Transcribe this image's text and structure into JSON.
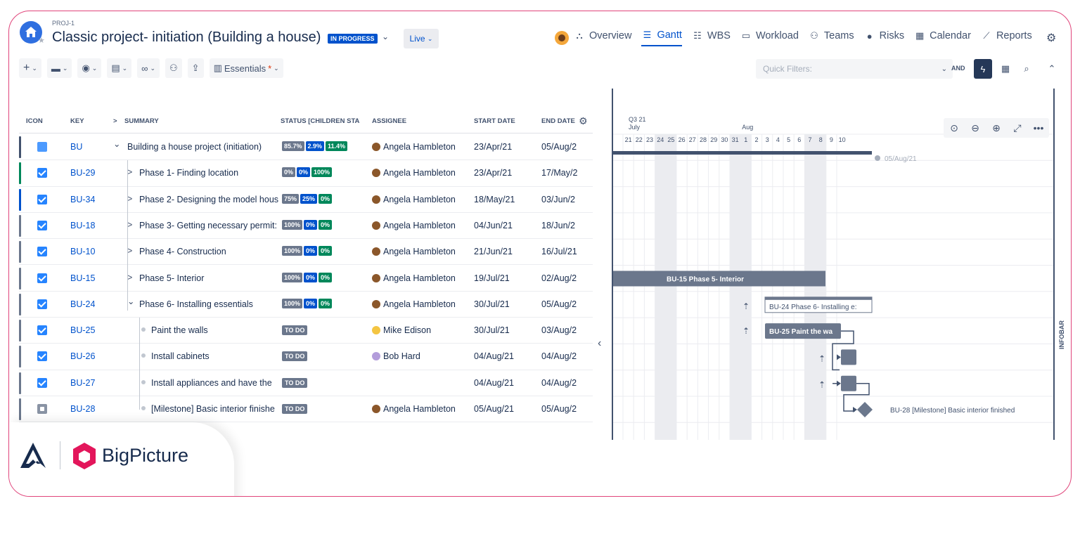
{
  "project": {
    "key": "PROJ-1",
    "title": "Classic project- initiation (Building a house)",
    "status": "IN PROGRESS",
    "mode": "Live"
  },
  "nav": [
    {
      "label": "Overview",
      "icon": "hierarchy-icon"
    },
    {
      "label": "Gantt",
      "icon": "gantt-icon",
      "active": true
    },
    {
      "label": "WBS",
      "icon": "list-icon"
    },
    {
      "label": "Workload",
      "icon": "workload-icon"
    },
    {
      "label": "Teams",
      "icon": "teams-icon"
    },
    {
      "label": "Risks",
      "icon": "risk-icon"
    },
    {
      "label": "Calendar",
      "icon": "calendar-icon"
    },
    {
      "label": "Reports",
      "icon": "chart-icon"
    }
  ],
  "toolbar": {
    "view_name": "Essentials",
    "view_required_mark": "*",
    "quick_filter_placeholder": "Quick Filters:",
    "and_label": "AND"
  },
  "columns": {
    "icon": "ICON",
    "key": "KEY",
    "summary": "SUMMARY",
    "status": "STATUS [CHILDREN STATUS]",
    "assignee": "ASSIGNEE",
    "start": "START DATE",
    "end": "END DATE"
  },
  "rows": [
    {
      "type": "story",
      "key": "BU",
      "caret": "⌄",
      "summary": "Building a house project (initiation)",
      "progress": [
        "85.7%",
        "2.9%",
        "11.4%"
      ],
      "assignee": "Angela Hambleton",
      "start": "23/Apr/21",
      "end": "05/Aug/2",
      "color": "#42526e"
    },
    {
      "type": "task",
      "key": "BU-29",
      "caret": ">",
      "summary": "Phase 1- Finding location",
      "progress": [
        "0%",
        "0%",
        "100%"
      ],
      "assignee": "Angela Hambleton",
      "start": "23/Apr/21",
      "end": "17/May/2",
      "color": "#00875a"
    },
    {
      "type": "task",
      "key": "BU-34",
      "caret": ">",
      "summary": "Phase 2- Designing the model hous",
      "progress": [
        "75%",
        "25%",
        "0%"
      ],
      "assignee": "Angela Hambleton",
      "start": "18/May/21",
      "end": "03/Jun/2",
      "color": "#0052cc"
    },
    {
      "type": "task",
      "key": "BU-18",
      "caret": ">",
      "summary": "Phase 3- Getting necessary permit:",
      "progress": [
        "100%",
        "0%",
        "0%"
      ],
      "assignee": "Angela Hambleton",
      "start": "04/Jun/21",
      "end": "18/Jun/2",
      "color": "#6b778c"
    },
    {
      "type": "task",
      "key": "BU-10",
      "caret": ">",
      "summary": "Phase 4- Construction",
      "progress": [
        "100%",
        "0%",
        "0%"
      ],
      "assignee": "Angela Hambleton",
      "start": "21/Jun/21",
      "end": "16/Jul/21",
      "color": "#6b778c"
    },
    {
      "type": "task",
      "key": "BU-15",
      "caret": ">",
      "summary": "Phase 5- Interior",
      "progress": [
        "100%",
        "0%",
        "0%"
      ],
      "assignee": "Angela Hambleton",
      "start": "19/Jul/21",
      "end": "02/Aug/2",
      "color": "#6b778c"
    },
    {
      "type": "task",
      "key": "BU-24",
      "caret": "⌄",
      "summary": "Phase 6- Installing essentials",
      "progress": [
        "100%",
        "0%",
        "0%"
      ],
      "assignee": "Angela Hambleton",
      "start": "30/Jul/21",
      "end": "05/Aug/2",
      "color": "#6b778c"
    },
    {
      "type": "task",
      "key": "BU-25",
      "caret": "",
      "summary": "Paint the walls",
      "todo": "TO DO",
      "assignee": "Mike Edison",
      "start": "30/Jul/21",
      "end": "03/Aug/2",
      "color": "#6b778c"
    },
    {
      "type": "task",
      "key": "BU-26",
      "caret": "",
      "summary": "Install cabinets",
      "todo": "TO DO",
      "assignee": "Bob Hard",
      "start": "04/Aug/21",
      "end": "04/Aug/2",
      "color": "#6b778c"
    },
    {
      "type": "task",
      "key": "BU-27",
      "caret": "",
      "summary": "Install appliances and have the",
      "todo": "TO DO",
      "assignee": "",
      "start": "04/Aug/21",
      "end": "04/Aug/2",
      "color": "#6b778c"
    },
    {
      "type": "milestone",
      "key": "BU-28",
      "caret": "",
      "summary": "[Milestone] Basic interior finishe",
      "todo": "TO DO",
      "assignee": "Angela Hambleton",
      "start": "05/Aug/21",
      "end": "05/Aug/2",
      "color": "#6b778c"
    }
  ],
  "gantt": {
    "quarter": "Q3 21",
    "months": [
      "July",
      "Aug"
    ],
    "days": [
      "21",
      "22",
      "23",
      "24",
      "25",
      "26",
      "27",
      "28",
      "29",
      "30",
      "31",
      "1",
      "2",
      "3",
      "4",
      "5",
      "6",
      "7",
      "8",
      "9",
      "10"
    ],
    "end_marker": "05/Aug/21",
    "bar_bu15": "BU-15  Phase 5- Interior",
    "bar_bu24": "BU-24  Phase 6- Installing e:",
    "bar_bu25": "BU-25  Paint the wa",
    "milestone_label": "BU-28  [Milestone] Basic interior finished"
  },
  "infobar": "INFOBAR",
  "brand": "BigPicture"
}
